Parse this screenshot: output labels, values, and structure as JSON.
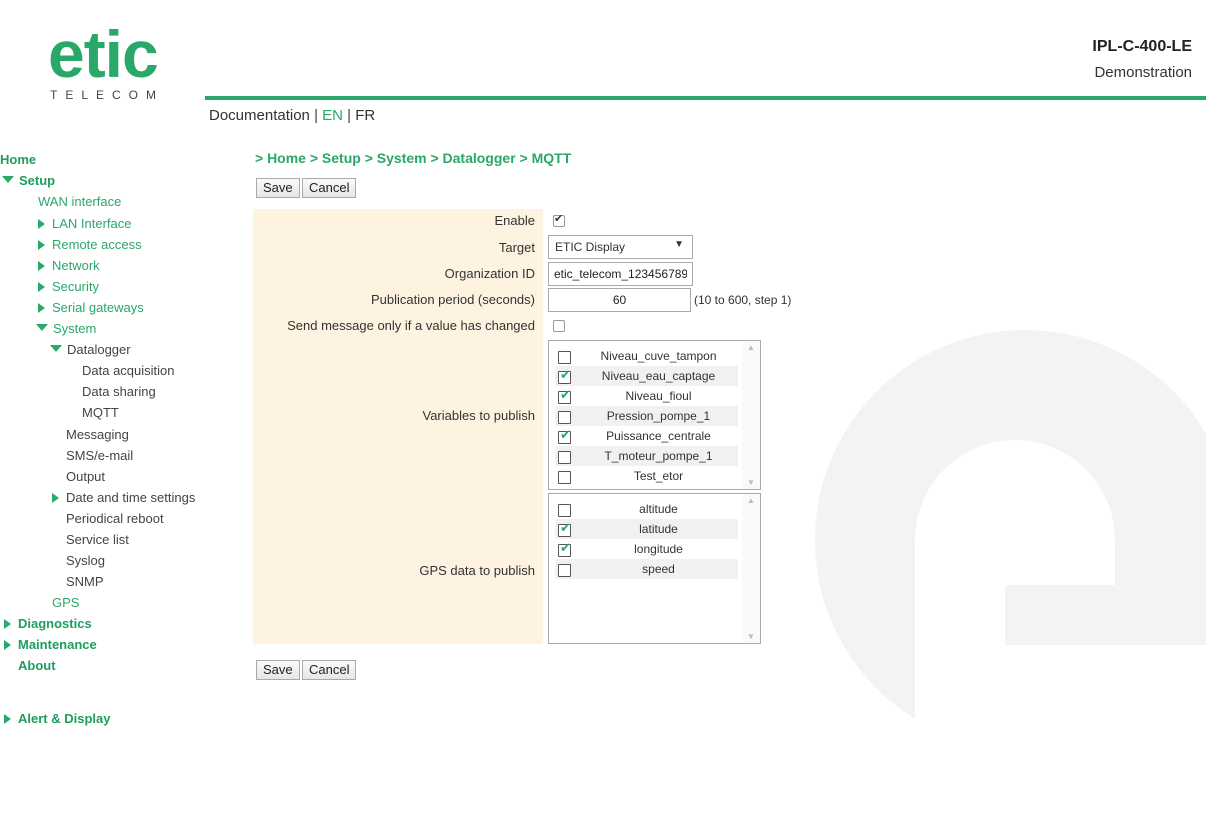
{
  "header": {
    "logo_text": "etic",
    "logo_subtitle": "TELECOM",
    "device_model": "IPL-C-400-LE",
    "device_mode": "Demonstration",
    "doc_label": "Documentation",
    "sep": "|",
    "lang_en": "EN",
    "lang_fr": "FR"
  },
  "sidebar": {
    "home": "Home",
    "setup": "Setup",
    "wan": "WAN interface",
    "lan": "LAN Interface",
    "remote": "Remote access",
    "network": "Network",
    "security": "Security",
    "serial": "Serial gateways",
    "system": "System",
    "datalogger": "Datalogger",
    "data_acq": "Data acquisition",
    "data_sharing": "Data sharing",
    "mqtt": "MQTT",
    "messaging": "Messaging",
    "sms": "SMS/e-mail",
    "output": "Output",
    "datetime": "Date and time settings",
    "reboot": "Periodical reboot",
    "services": "Service list",
    "syslog": "Syslog",
    "snmp": "SNMP",
    "gps": "GPS",
    "diagnostics": "Diagnostics",
    "maintenance": "Maintenance",
    "about": "About",
    "alert": "Alert & Display"
  },
  "main": {
    "breadcrumb": "> Home > Setup > System > Datalogger > MQTT",
    "save": "Save",
    "cancel": "Cancel",
    "labels": {
      "enable": "Enable",
      "target": "Target",
      "org_id": "Organization ID",
      "period": "Publication period (seconds)",
      "changed_only": "Send message only if a value has changed",
      "variables": "Variables to publish",
      "gps": "GPS data to publish"
    },
    "enable_checked": true,
    "changed_only_checked": false,
    "target_value": "ETIC Display",
    "org_id_value": "etic_telecom_123456789",
    "period_value": "60",
    "period_hint": "(10 to 600, step 1)",
    "variables": [
      {
        "name": "Niveau_cuve_tampon",
        "checked": false
      },
      {
        "name": "Niveau_eau_captage",
        "checked": true
      },
      {
        "name": "Niveau_fioul",
        "checked": true
      },
      {
        "name": "Pression_pompe_1",
        "checked": false
      },
      {
        "name": "Puissance_centrale",
        "checked": true
      },
      {
        "name": "T_moteur_pompe_1",
        "checked": false
      },
      {
        "name": "Test_etor",
        "checked": false
      }
    ],
    "gps_fields": [
      {
        "name": "altitude",
        "checked": false
      },
      {
        "name": "latitude",
        "checked": true
      },
      {
        "name": "longitude",
        "checked": true
      },
      {
        "name": "speed",
        "checked": false
      }
    ]
  },
  "colors": {
    "accent": "#2aa86a",
    "form_bg": "#fdf3e0"
  }
}
